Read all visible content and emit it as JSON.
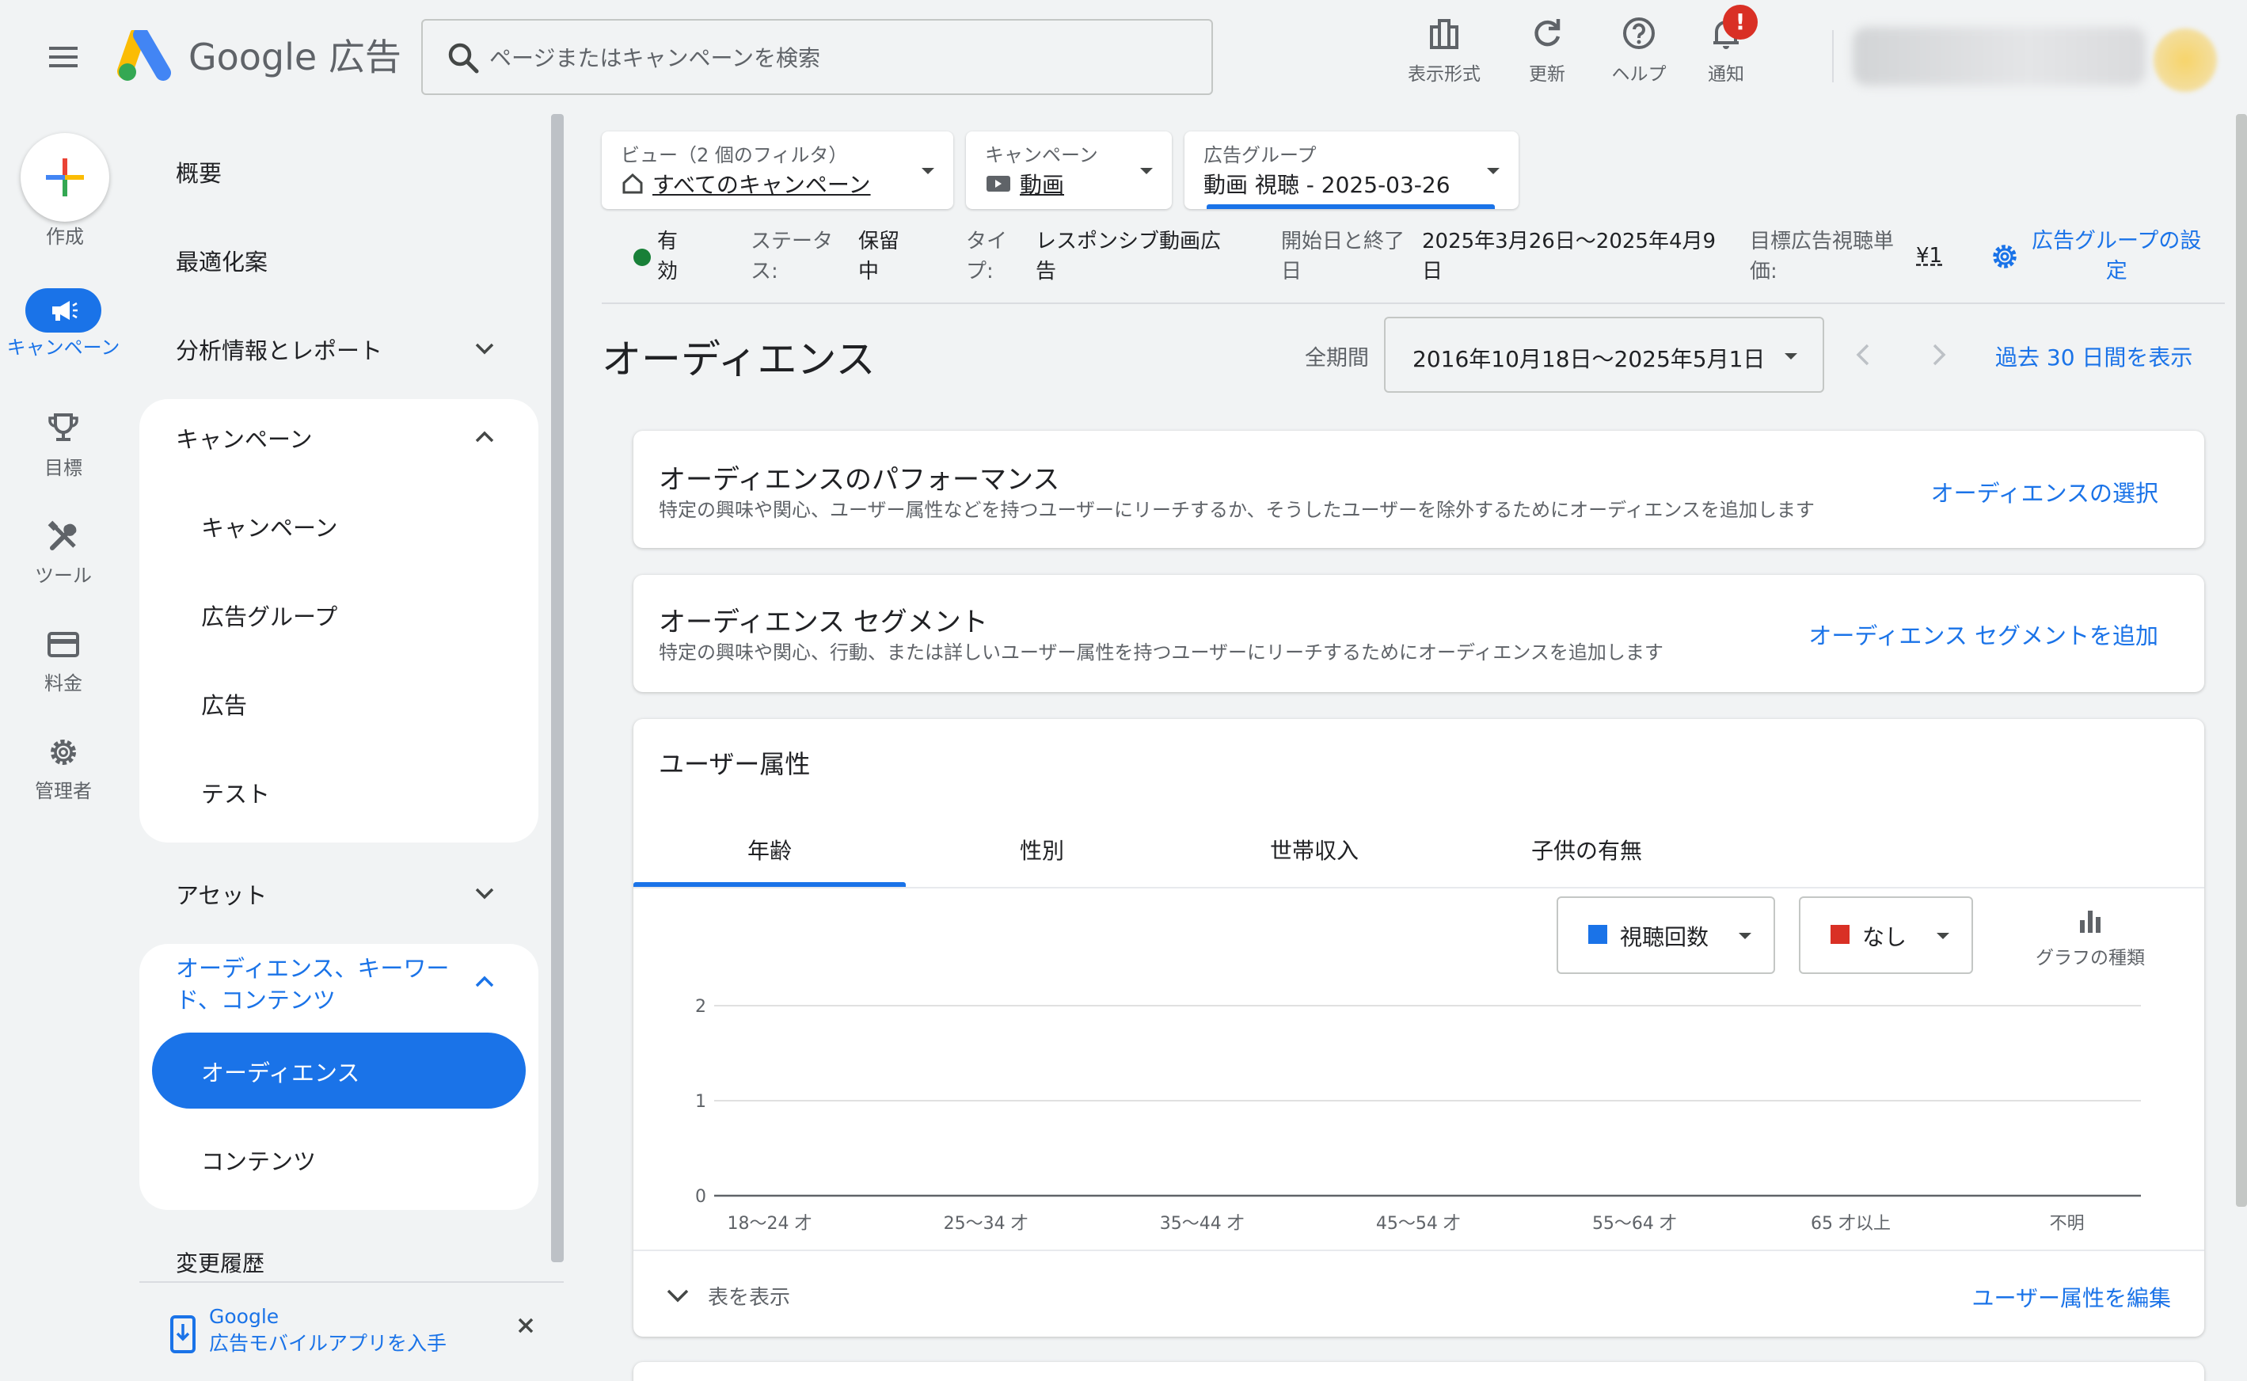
{
  "header": {
    "brand": "Google 広告",
    "search_placeholder": "ページまたはキャンペーンを検索",
    "tools": [
      {
        "label": "表示形式",
        "icon": "view-mode-icon"
      },
      {
        "label": "更新",
        "icon": "refresh-icon"
      },
      {
        "label": "ヘルプ",
        "icon": "help-icon"
      },
      {
        "label": "通知",
        "icon": "bell-icon"
      }
    ],
    "notification_badge": "!"
  },
  "rail": {
    "create_label": "作成",
    "items": [
      {
        "label": "キャンペーン",
        "icon": "megaphone-icon",
        "active": true
      },
      {
        "label": "目標",
        "icon": "trophy-icon"
      },
      {
        "label": "ツール",
        "icon": "tools-icon"
      },
      {
        "label": "料金",
        "icon": "credit-card-icon"
      },
      {
        "label": "管理者",
        "icon": "gear-icon"
      }
    ]
  },
  "nav": {
    "overview": "概要",
    "recommendations": "最適化案",
    "insights": "分析情報とレポート",
    "campaigns_group": "キャンペーン",
    "campaigns_sub": [
      "キャンペーン",
      "広告グループ",
      "広告",
      "テスト"
    ],
    "assets": "アセット",
    "audience_group_line1": "オーディエンス、キーワー",
    "audience_group_line2": "ド、コンテンツ",
    "audience_active": "オーディエンス",
    "content": "コンテンツ",
    "change_history": "変更履歴",
    "promo_line1": "Google",
    "promo_line2": "広告モバイルアプリを入手"
  },
  "filters": {
    "view": {
      "small": "ビュー（2 個のフィルタ）",
      "value": "すべてのキャンペーン"
    },
    "campaign": {
      "small": "キャンペーン",
      "value": "動画"
    },
    "adgroup": {
      "small": "広告グループ",
      "value": "動画 視聴 - 2025-03-26"
    }
  },
  "status": {
    "state_1": "有",
    "state_2": "効",
    "status_label_1": "ステータ",
    "status_label_2": "ス:",
    "status_value_1": "保留",
    "status_value_2": "中",
    "type_label_1": "タイ",
    "type_label_2": "プ:",
    "type_value_1": "レスポンシブ動画広",
    "type_value_2": "告",
    "dates_label_1": "開始日と終了",
    "dates_label_2": "日",
    "dates_value_1": "2025年3月26日〜2025年4月9",
    "dates_value_2": "日",
    "cpv_label_1": "目標広告視聴単",
    "cpv_label_2": "価:",
    "cpv_value": "¥1",
    "settings_link_1": "広告グループの設",
    "settings_link_2": "定"
  },
  "content": {
    "title": "オーディエンス",
    "period_label": "全期間",
    "date_range": "2016年10月18日〜2025年5月1日",
    "last30_link": "過去 30 日間を表示"
  },
  "cards": {
    "performance": {
      "title": "オーディエンスのパフォーマンス",
      "desc": "特定の興味や関心、ユーザー属性などを持つユーザーにリーチするか、そうしたユーザーを除外するためにオーディエンスを追加します",
      "link": "オーディエンスの選択"
    },
    "segment": {
      "title": "オーディエンス セグメント",
      "desc": "特定の興味や関心、行動、または詳しいユーザー属性を持つユーザーにリーチするためにオーディエンスを追加します",
      "link": "オーディエンス セグメントを追加"
    },
    "demographics": {
      "title": "ユーザー属性",
      "tabs": [
        "年齢",
        "性別",
        "世帯収入",
        "子供の有無"
      ],
      "metric1": "視聴回数",
      "metric2": "なし",
      "chart_type_label": "グラフの種類",
      "show_table": "表を表示",
      "edit_link": "ユーザー属性を編集"
    }
  },
  "colors": {
    "accent": "#1a73e8",
    "metric1": "#1a73e8",
    "metric2": "#d93025",
    "status_green": "#188038"
  },
  "chart_data": {
    "type": "bar",
    "title": "",
    "xlabel": "",
    "ylabel": "",
    "categories": [
      "18〜24 才",
      "25〜34 才",
      "35〜44 才",
      "45〜54 才",
      "55〜64 才",
      "65 才以上",
      "不明"
    ],
    "series": [
      {
        "name": "視聴回数",
        "values": [
          0,
          0,
          0,
          0,
          0,
          0,
          0
        ]
      }
    ],
    "ylim": [
      0,
      2
    ],
    "yticks": [
      0,
      1,
      2
    ],
    "grid": true
  }
}
